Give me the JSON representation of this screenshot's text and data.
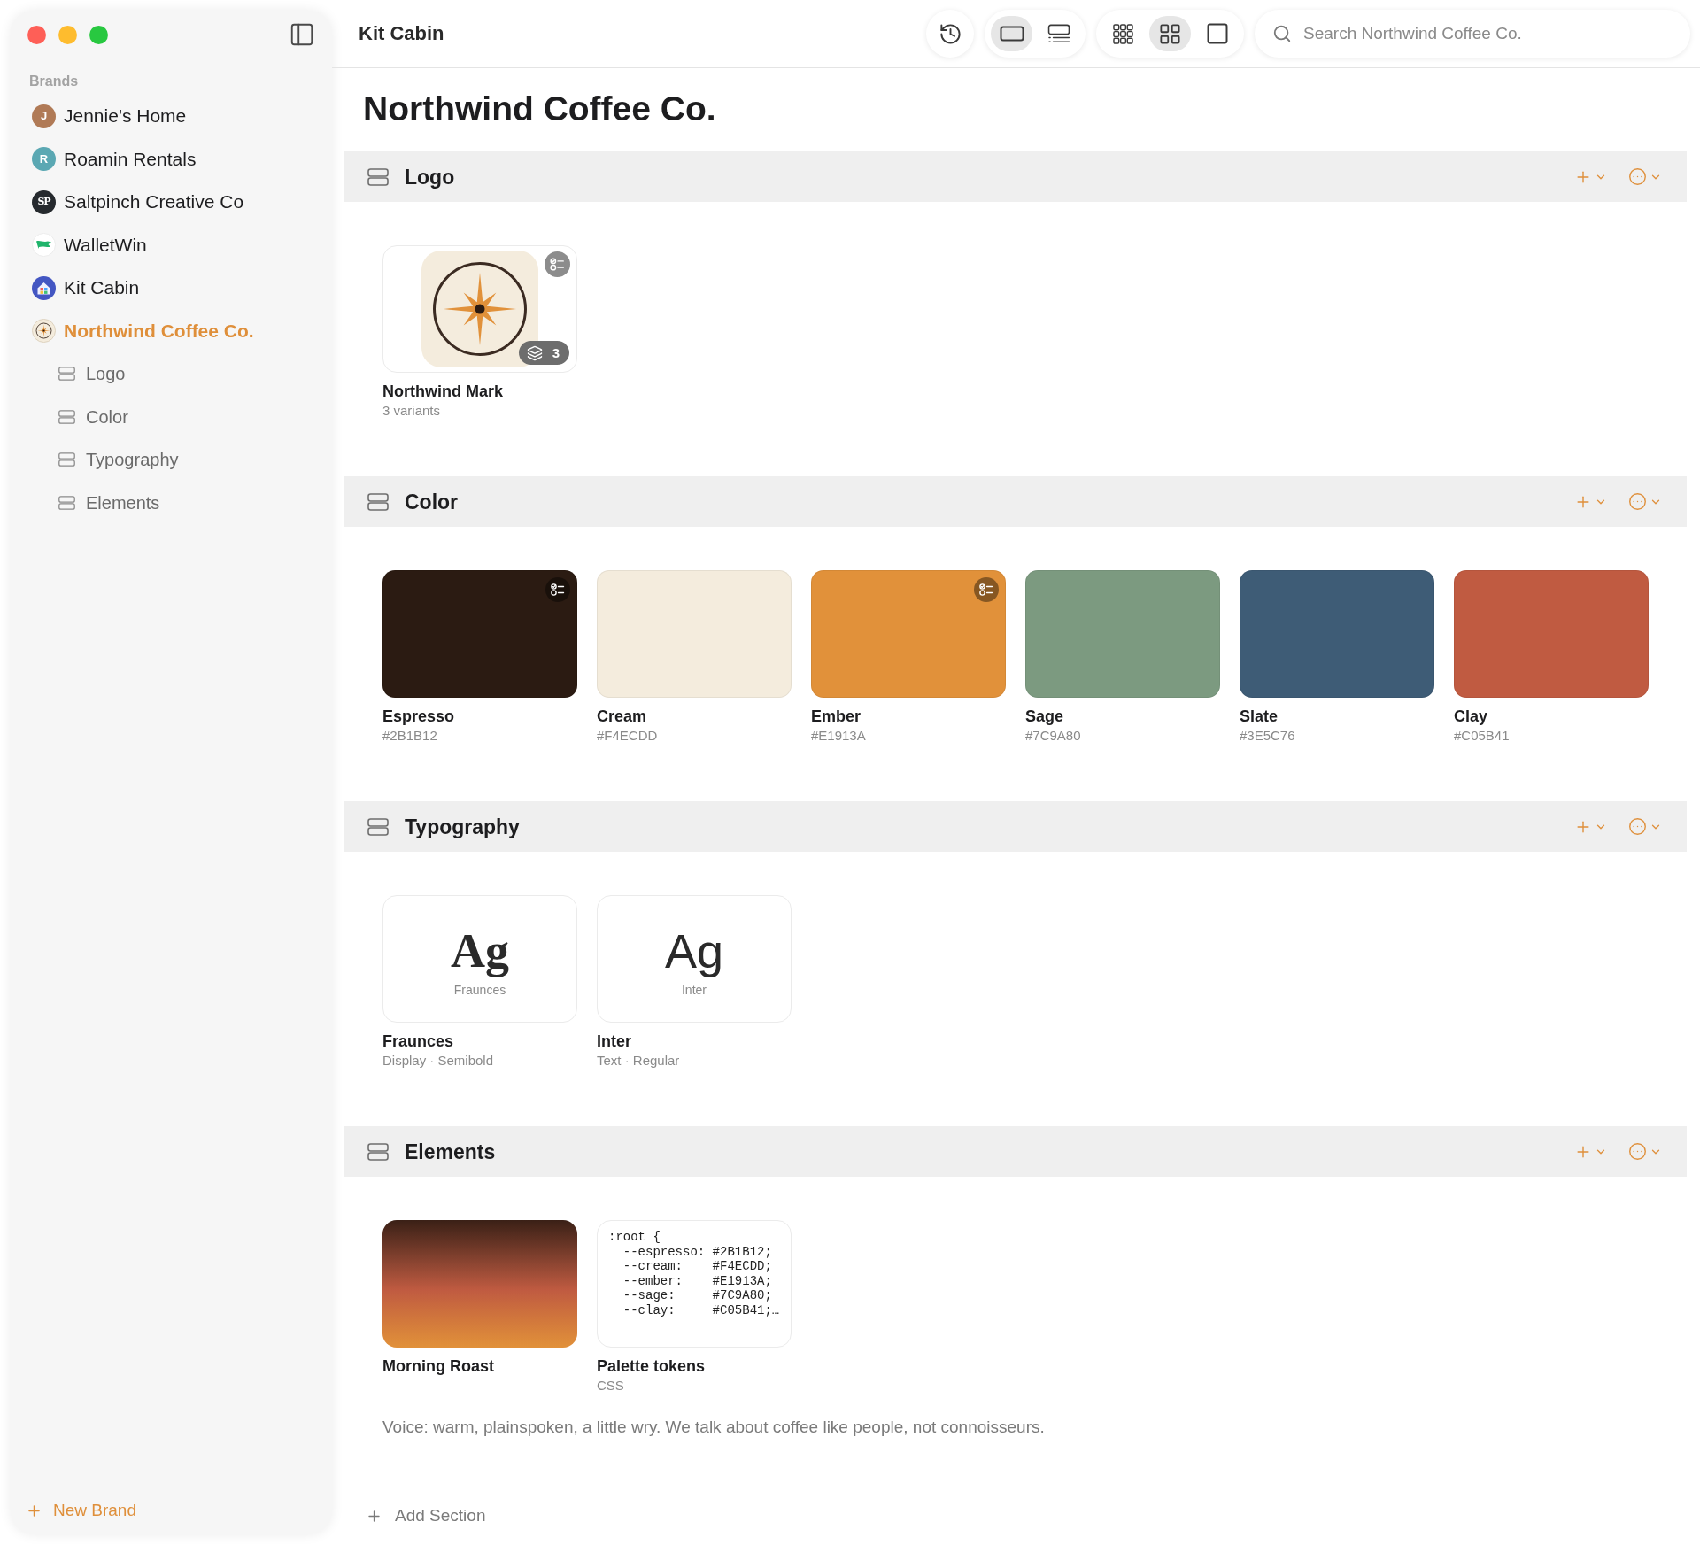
{
  "window": {
    "title": "Kit Cabin"
  },
  "sidebar": {
    "heading": "Brands",
    "items": [
      {
        "label": "Jennie's Home",
        "kind": "letter",
        "avatar_text": "J",
        "color": "#b07a56",
        "selected": false
      },
      {
        "label": "Roamin Rentals",
        "kind": "letter",
        "avatar_text": "R",
        "color": "#5ba8b3",
        "selected": false
      },
      {
        "label": "Saltpinch Creative Co",
        "kind": "monogram",
        "avatar_text": "SP",
        "selected": false
      },
      {
        "label": "WalletWin",
        "kind": "flag",
        "selected": false
      },
      {
        "label": "Kit Cabin",
        "kind": "house",
        "selected": false
      },
      {
        "label": "Northwind Coffee Co.",
        "kind": "compass",
        "selected": true,
        "children": [
          {
            "label": "Logo",
            "selected": false
          },
          {
            "label": "Color",
            "selected": false
          },
          {
            "label": "Typography",
            "selected": false
          },
          {
            "label": "Elements",
            "selected": false
          }
        ]
      }
    ],
    "new_brand_button": "New Brand"
  },
  "toolbar": {
    "view_modes": [
      {
        "kind": "cards",
        "selected": true
      },
      {
        "kind": "list",
        "selected": false
      }
    ],
    "grid_sizes": [
      {
        "kind": "dense",
        "selected": false
      },
      {
        "kind": "grid",
        "selected": true
      },
      {
        "kind": "single",
        "selected": false
      }
    ],
    "search": {
      "placeholder": "Search Northwind Coffee Co."
    }
  },
  "page": {
    "title": "Northwind Coffee Co.",
    "sections": [
      {
        "title": "Logo",
        "items": [
          {
            "kind": "logo",
            "name": "Northwind Mark",
            "subtitle": "3 variants",
            "variant_count": "3",
            "checklist_badge": true
          }
        ]
      },
      {
        "title": "Color",
        "items": [
          {
            "kind": "swatch",
            "name": "Espresso",
            "hex": "#2B1B12",
            "color": "#2b1b12",
            "checklist_badge": true
          },
          {
            "kind": "swatch",
            "name": "Cream",
            "hex": "#F4ECDD",
            "color": "#f4ecdd",
            "checklist_badge": false
          },
          {
            "kind": "swatch",
            "name": "Ember",
            "hex": "#E1913A",
            "color": "#e1913a",
            "checklist_badge": true
          },
          {
            "kind": "swatch",
            "name": "Sage",
            "hex": "#7C9A80",
            "color": "#7c9a80",
            "checklist_badge": false
          },
          {
            "kind": "swatch",
            "name": "Slate",
            "hex": "#3E5C76",
            "color": "#3e5c76",
            "checklist_badge": false
          },
          {
            "kind": "swatch",
            "name": "Clay",
            "hex": "#C05B41",
            "color": "#c05b41",
            "checklist_badge": false
          }
        ]
      },
      {
        "title": "Typography",
        "items": [
          {
            "kind": "serif",
            "sample": "Ag",
            "sample_label": "Fraunces",
            "name": "Fraunces",
            "subtitle": "Display · Semibold"
          },
          {
            "kind": "sans",
            "sample": "Ag",
            "sample_label": "Inter",
            "name": "Inter",
            "subtitle": "Text · Regular"
          }
        ]
      },
      {
        "title": "Elements",
        "items": [
          {
            "kind": "gradient",
            "name": "Morning Roast"
          },
          {
            "kind": "code",
            "code": [
              ":root {",
              "  --espresso: #2B1B12;",
              "  --cream:    #F4ECDD;",
              "  --ember:    #E1913A;",
              "  --sage:     #7C9A80;",
              "  --clay:     #C05B41;…"
            ],
            "name": "Palette tokens",
            "subtitle": "CSS"
          }
        ],
        "note": "Voice: warm, plainspoken, a little wry. We talk about coffee like people, not connoisseurs."
      }
    ],
    "add_section_button": "Add Section"
  }
}
